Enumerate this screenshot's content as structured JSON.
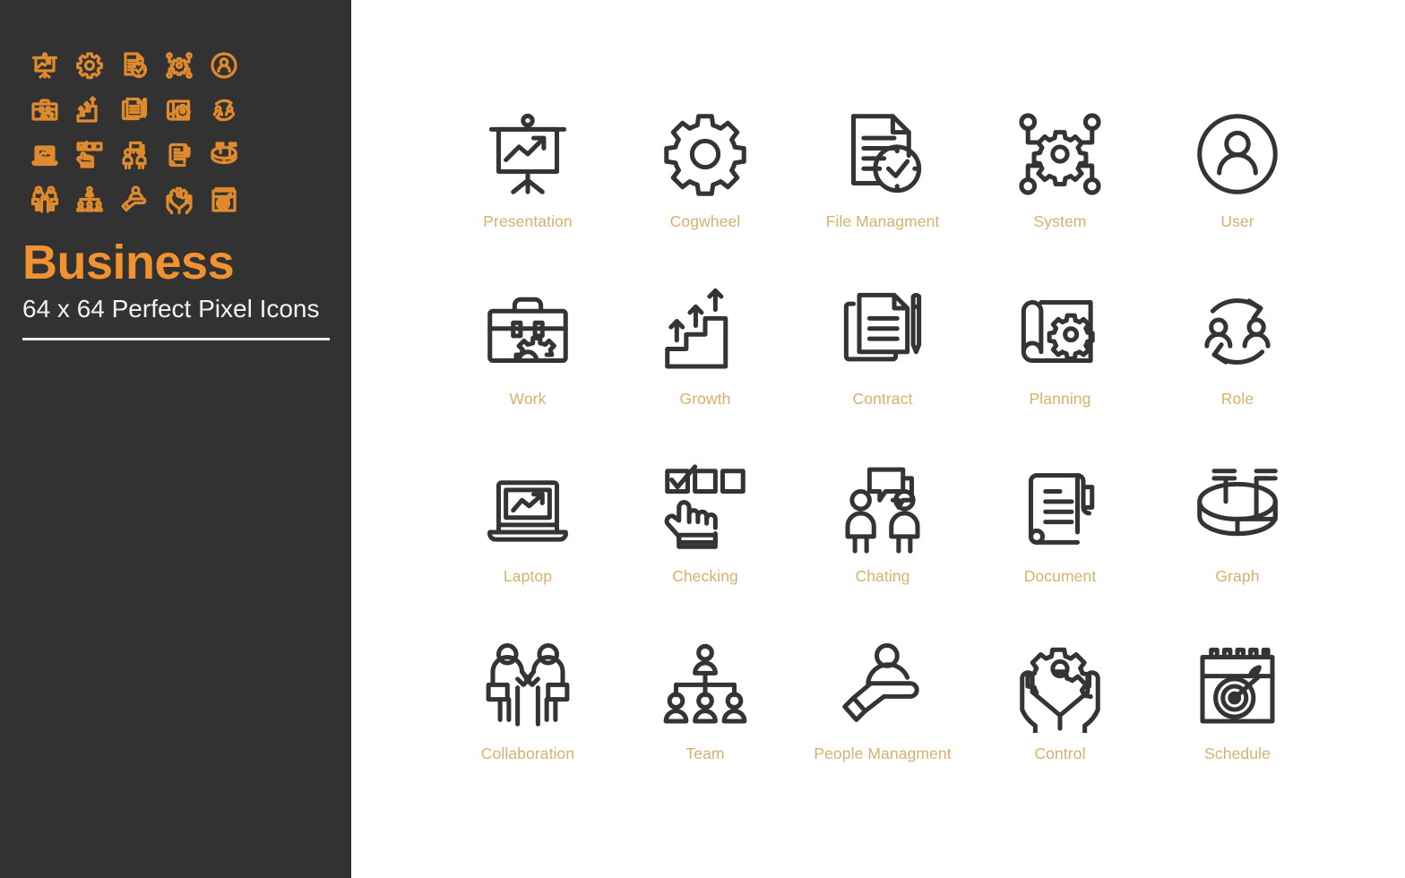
{
  "brand": {
    "title": "Business",
    "subtitle": "64 x 64 Perfect Pixel Icons",
    "title_color": "#f0922f",
    "subtitle_color": "#f2f2f2",
    "panel_color": "#333232"
  },
  "theme": {
    "background": "#ffffff",
    "icon_stroke": "#343434",
    "label_color": "#d8b06b",
    "mini_icon_color": "#e08a2e"
  },
  "icons": [
    {
      "label": "Presentation",
      "name": "presentation-icon"
    },
    {
      "label": "Cogwheel",
      "name": "cogwheel-icon"
    },
    {
      "label": "File Managment",
      "name": "file-management-icon"
    },
    {
      "label": "System",
      "name": "system-icon"
    },
    {
      "label": "User",
      "name": "user-icon"
    },
    {
      "label": "Work",
      "name": "work-icon"
    },
    {
      "label": "Growth",
      "name": "growth-icon"
    },
    {
      "label": "Contract",
      "name": "contract-icon"
    },
    {
      "label": "Planning",
      "name": "planning-icon"
    },
    {
      "label": "Role",
      "name": "role-icon"
    },
    {
      "label": "Laptop",
      "name": "laptop-icon"
    },
    {
      "label": "Checking",
      "name": "checking-icon"
    },
    {
      "label": "Chating",
      "name": "chatting-icon"
    },
    {
      "label": "Document",
      "name": "document-icon"
    },
    {
      "label": "Graph",
      "name": "graph-icon"
    },
    {
      "label": "Collaboration",
      "name": "collaboration-icon"
    },
    {
      "label": "Team",
      "name": "team-icon"
    },
    {
      "label": "People Managment",
      "name": "people-management-icon"
    },
    {
      "label": "Control",
      "name": "control-icon"
    },
    {
      "label": "Schedule",
      "name": "schedule-icon"
    }
  ]
}
